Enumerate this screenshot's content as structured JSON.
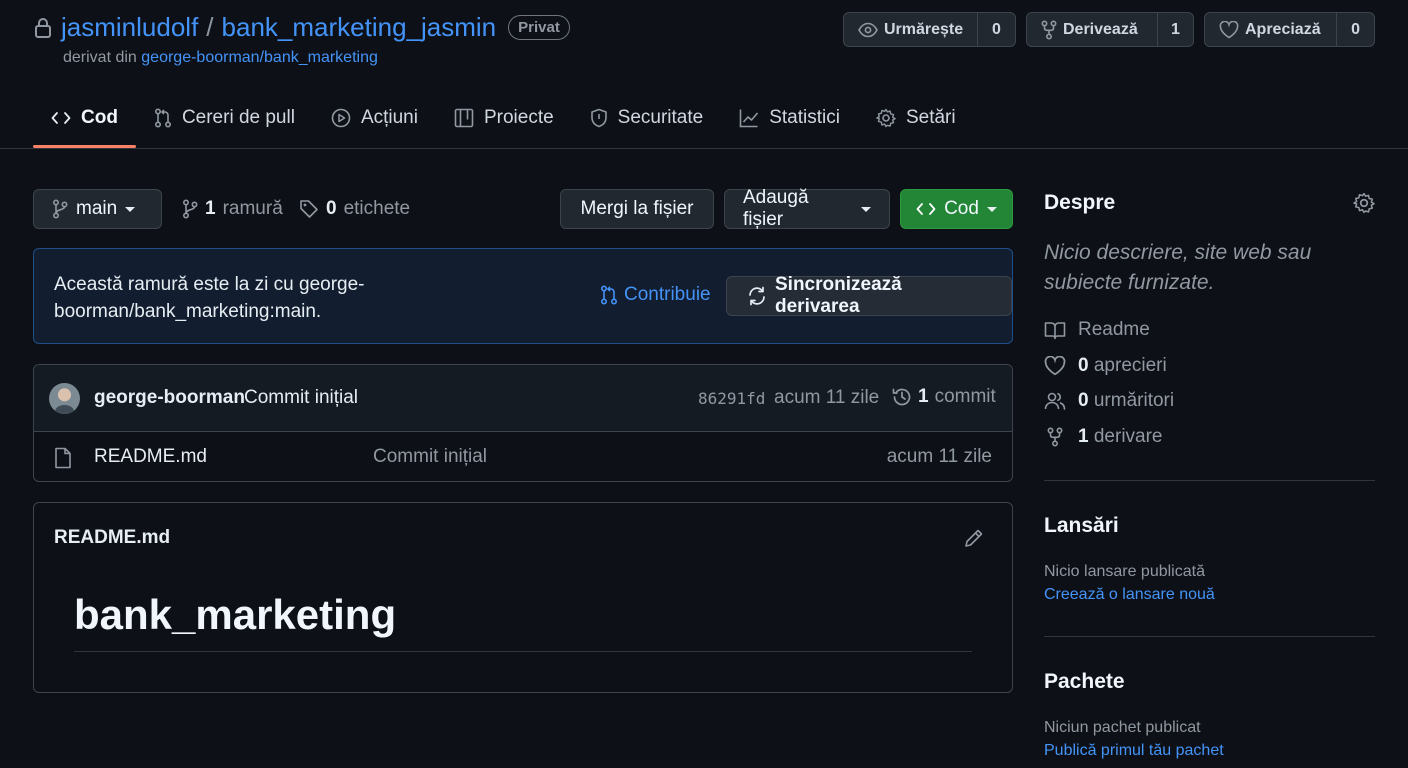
{
  "repo": {
    "owner": "jasminludolf",
    "separator": "/",
    "name": "bank_marketing_jasmin",
    "visibility": "Privat",
    "forked_prefix": "derivat din",
    "forked_from": "george-boorman/bank_marketing"
  },
  "header_buttons": {
    "watch": {
      "label": "Urmărește",
      "count": "0",
      "icon": "eye-icon"
    },
    "fork": {
      "label": "Derivează",
      "count": "1",
      "icon": "repo-forked-icon"
    },
    "star": {
      "label": "Apreciază",
      "count": "0",
      "icon": "heart-icon"
    }
  },
  "tabs": [
    {
      "label": "Cod",
      "icon": "code-icon",
      "active": true
    },
    {
      "label": "Cereri de pull",
      "icon": "git-pull-request-icon"
    },
    {
      "label": "Acțiuni",
      "icon": "play-icon"
    },
    {
      "label": "Proiecte",
      "icon": "table-icon"
    },
    {
      "label": "Securitate",
      "icon": "shield-icon"
    },
    {
      "label": "Statistici",
      "icon": "graph-icon"
    },
    {
      "label": "Setări",
      "icon": "gear-icon"
    }
  ],
  "branch_bar": {
    "branch": "main",
    "branches_count": "1",
    "branches_label": "ramură",
    "tags_count": "0",
    "tags_label": "etichete",
    "goto_file": "Mergi la fișier",
    "add_file": "Adaugă fișier",
    "code": "Cod"
  },
  "fork_status": {
    "message": "Această ramură este la zi cu george-boorman/bank_marketing:main.",
    "contribute": "Contribuie",
    "sync": "Sincronizează derivarea"
  },
  "latest_commit": {
    "author": "george-boorman",
    "message": "Commit inițial",
    "hash": "86291fd",
    "time": "acum 11 zile",
    "commit_count": "1",
    "commit_label": "commit"
  },
  "files": [
    {
      "name": "README.md",
      "message": "Commit inițial",
      "time": "acum 11 zile"
    }
  ],
  "readme": {
    "title": "README.md",
    "heading": "bank_marketing"
  },
  "about": {
    "title": "Despre",
    "description": "Nicio descriere, site web sau subiecte furnizate.",
    "readme": "Readme",
    "stars_count": "0",
    "stars_label": "aprecieri",
    "watchers_count": "0",
    "watchers_label": "urmăritori",
    "forks_count": "1",
    "forks_label": "derivare"
  },
  "releases": {
    "title": "Lansări",
    "empty": "Nicio lansare publicată",
    "create": "Creează o lansare nouă"
  },
  "packages": {
    "title": "Pachete",
    "empty": "Niciun pachet publicat",
    "publish": "Publică primul tău pachet"
  },
  "colors": {
    "background": "#0d1117",
    "link": "#4493f8",
    "active_tab_underline": "#f78166",
    "primary_button": "#238636",
    "fork_banner_border": "#1f4d87"
  }
}
